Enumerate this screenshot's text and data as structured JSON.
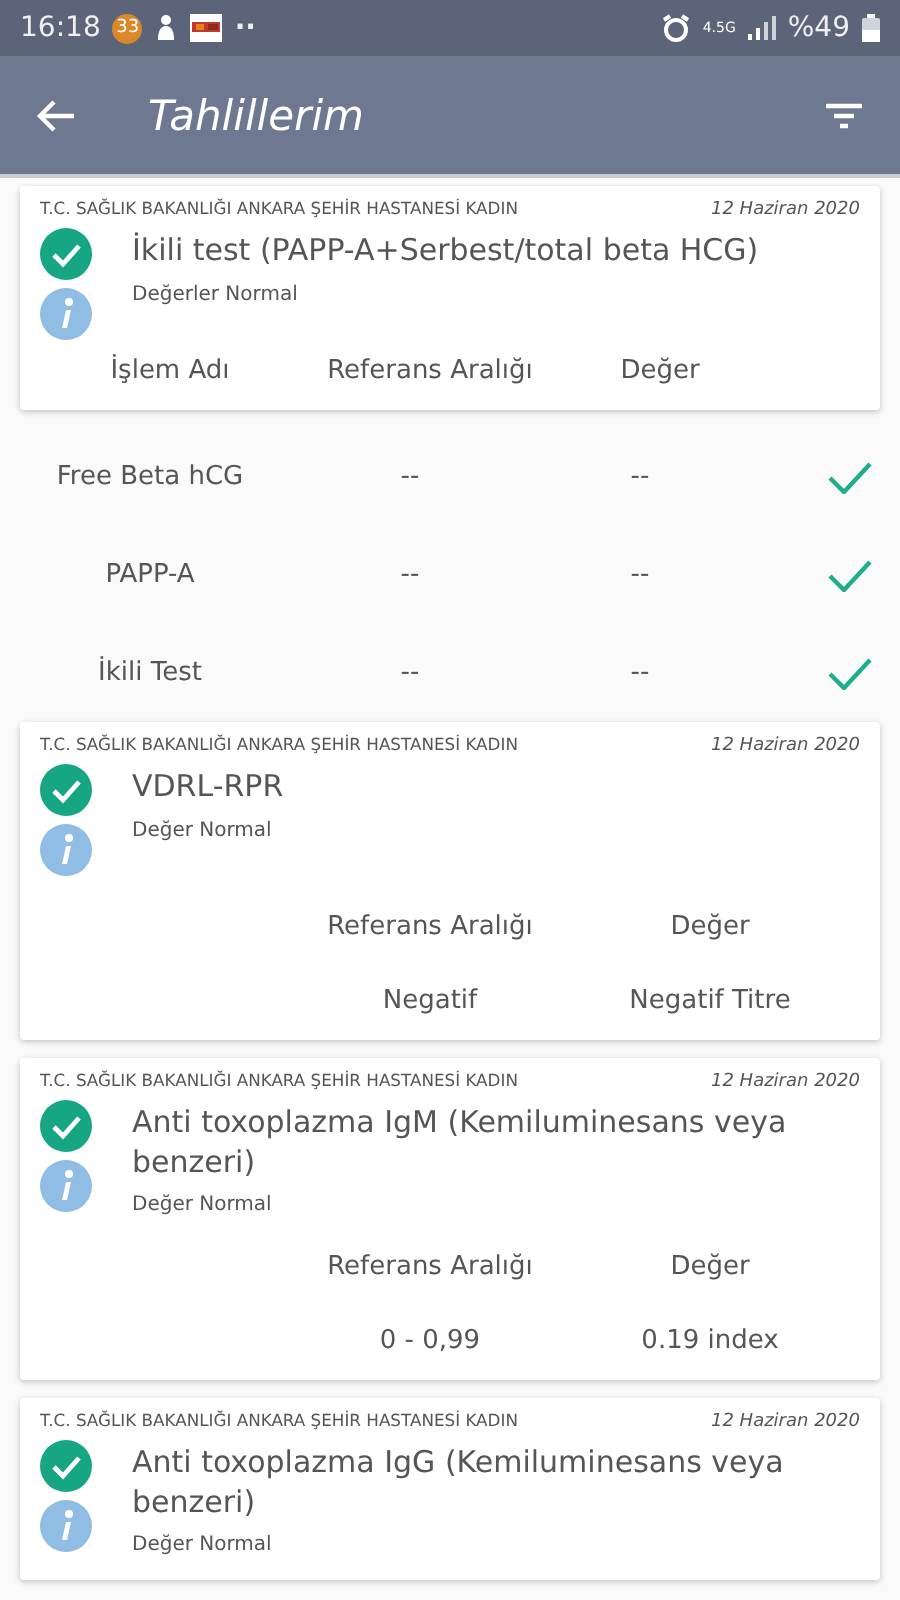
{
  "status_bar": {
    "time": "16:18",
    "badge": "33",
    "more": "··",
    "network": "4.5G",
    "battery": "%49"
  },
  "app_bar": {
    "title": "Tahlillerim"
  },
  "cards": [
    {
      "kind": "detailed",
      "hospital": "T.C. SAĞLIK BAKANLIĞI ANKARA ŞEHİR HASTANESİ KADIN",
      "date": "12 Haziran 2020",
      "title": "İkili test (PAPP-A+Serbest/total beta HCG)",
      "summary": "Değerler Normal",
      "columns": [
        "İşlem Adı",
        "Referans Aralığı",
        "Değer"
      ],
      "rows": [
        {
          "name": "Free Beta hCG",
          "range": "--",
          "value": "--",
          "ok": true
        },
        {
          "name": "PAPP-A",
          "range": "--",
          "value": "--",
          "ok": true
        },
        {
          "name": "İkili Test",
          "range": "--",
          "value": "--",
          "ok": true
        }
      ]
    },
    {
      "kind": "single",
      "hospital": "T.C. SAĞLIK BAKANLIĞI ANKARA ŞEHİR HASTANESİ KADIN",
      "date": "12 Haziran 2020",
      "title": "VDRL-RPR",
      "summary": "Değer Normal",
      "columns": [
        "Referans Aralığı",
        "Değer"
      ],
      "range": "Negatif",
      "value": "Negatif Titre"
    },
    {
      "kind": "single",
      "hospital": "T.C. SAĞLIK BAKANLIĞI ANKARA ŞEHİR HASTANESİ KADIN",
      "date": "12 Haziran 2020",
      "title": "Anti toxoplazma IgM (Kemiluminesans veya benzeri)",
      "summary": "Değer Normal",
      "columns": [
        "Referans Aralığı",
        "Değer"
      ],
      "range": "0 - 0,99",
      "value": "0.19 index"
    },
    {
      "kind": "single",
      "hospital": "T.C. SAĞLIK BAKANLIĞI ANKARA ŞEHİR HASTANESİ KADIN",
      "date": "12 Haziran 2020",
      "title": "Anti toxoplazma IgG (Kemiluminesans veya benzeri)",
      "summary": "Değer Normal"
    }
  ]
}
